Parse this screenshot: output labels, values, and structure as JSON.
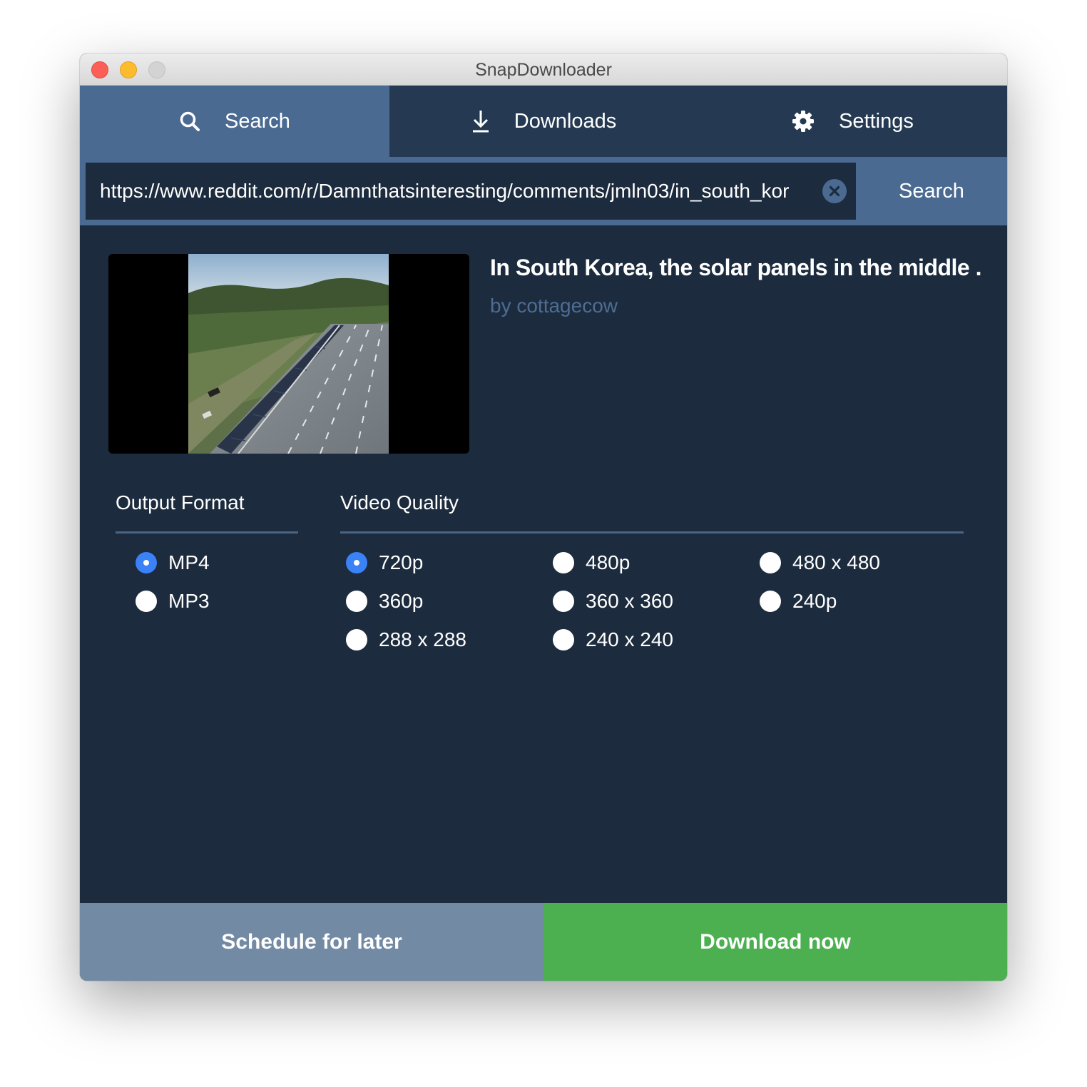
{
  "window": {
    "title": "SnapDownloader"
  },
  "tabs": [
    {
      "label": "Search",
      "icon": "search-icon",
      "active": true
    },
    {
      "label": "Downloads",
      "icon": "download-icon",
      "active": false
    },
    {
      "label": "Settings",
      "icon": "gear-icon",
      "active": false
    }
  ],
  "search": {
    "url_value": "https://www.reddit.com/r/Damnthatsinteresting/comments/jmln03/in_south_kor",
    "button_label": "Search"
  },
  "video": {
    "title": "In South Korea, the solar panels in the middle ...",
    "author": "by cottagecow"
  },
  "output_format": {
    "label": "Output Format",
    "options": [
      {
        "label": "MP4",
        "selected": true
      },
      {
        "label": "MP3",
        "selected": false
      }
    ]
  },
  "video_quality": {
    "label": "Video Quality",
    "options": [
      {
        "label": "720p",
        "selected": true
      },
      {
        "label": "360p",
        "selected": false
      },
      {
        "label": "288 x 288",
        "selected": false
      },
      {
        "label": "480p",
        "selected": false
      },
      {
        "label": "360 x 360",
        "selected": false
      },
      {
        "label": "240 x 240",
        "selected": false
      },
      {
        "label": "480 x 480",
        "selected": false
      },
      {
        "label": "240p",
        "selected": false
      }
    ]
  },
  "footer": {
    "schedule_label": "Schedule for later",
    "download_label": "Download now"
  },
  "colors": {
    "background": "#1c2b3d",
    "tab_bar": "#253a52",
    "accent": "#4a6a92",
    "radio_selected": "#3b82f6",
    "schedule_button": "#728aa4",
    "download_button": "#4caf50"
  }
}
